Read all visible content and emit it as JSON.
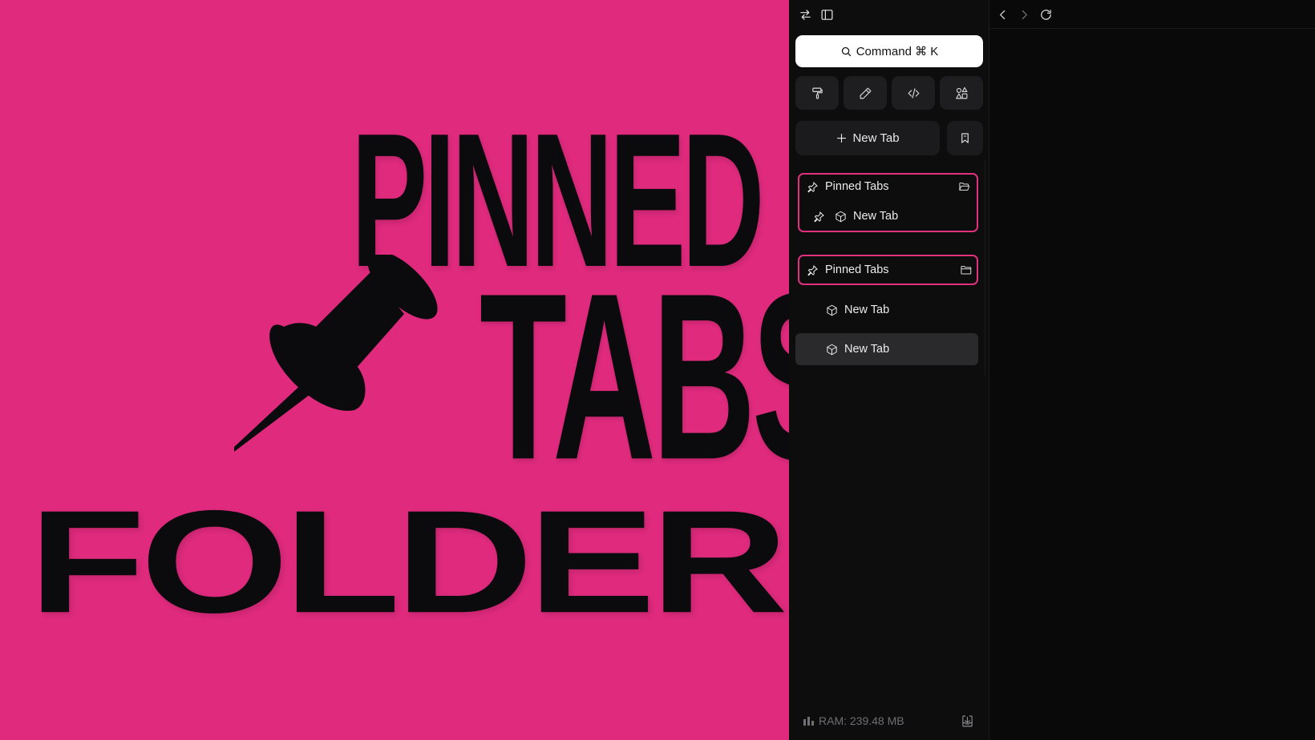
{
  "poster": {
    "line1": "PINNED",
    "line2": "TABS",
    "line3": "FOLDER",
    "pin_icon": "pushpin-icon",
    "background_color": "#df2a7d",
    "text_color": "#0b0b0d"
  },
  "toolbar": {
    "toggle_icon": "swap-arrows-icon",
    "sidebar_icon": "sidebar-panel-icon",
    "back_icon": "chevron-left-icon",
    "forward_icon": "chevron-right-icon",
    "reload_icon": "reload-icon"
  },
  "command_bar": {
    "label": "Command ⌘ K",
    "icon": "search-icon"
  },
  "tools": [
    {
      "name": "paint-roller-icon"
    },
    {
      "name": "pen-icon"
    },
    {
      "name": "code-icon"
    },
    {
      "name": "shapes-icon"
    }
  ],
  "new_tab_button": {
    "label": "New Tab",
    "icon": "plus-icon"
  },
  "bookmark_button": {
    "icon": "bookmark-icon"
  },
  "folders": [
    {
      "name": "Pinned Tabs",
      "state": "open",
      "tabs": [
        {
          "label": "New Tab",
          "pinned": true
        }
      ]
    },
    {
      "name": "Pinned Tabs",
      "state": "closed",
      "tabs": []
    }
  ],
  "tabs": [
    {
      "label": "New Tab",
      "active": false
    },
    {
      "label": "New Tab",
      "active": true
    }
  ],
  "status": {
    "ram": "RAM: 239.48 MB"
  },
  "accent_color": "#e2307f"
}
